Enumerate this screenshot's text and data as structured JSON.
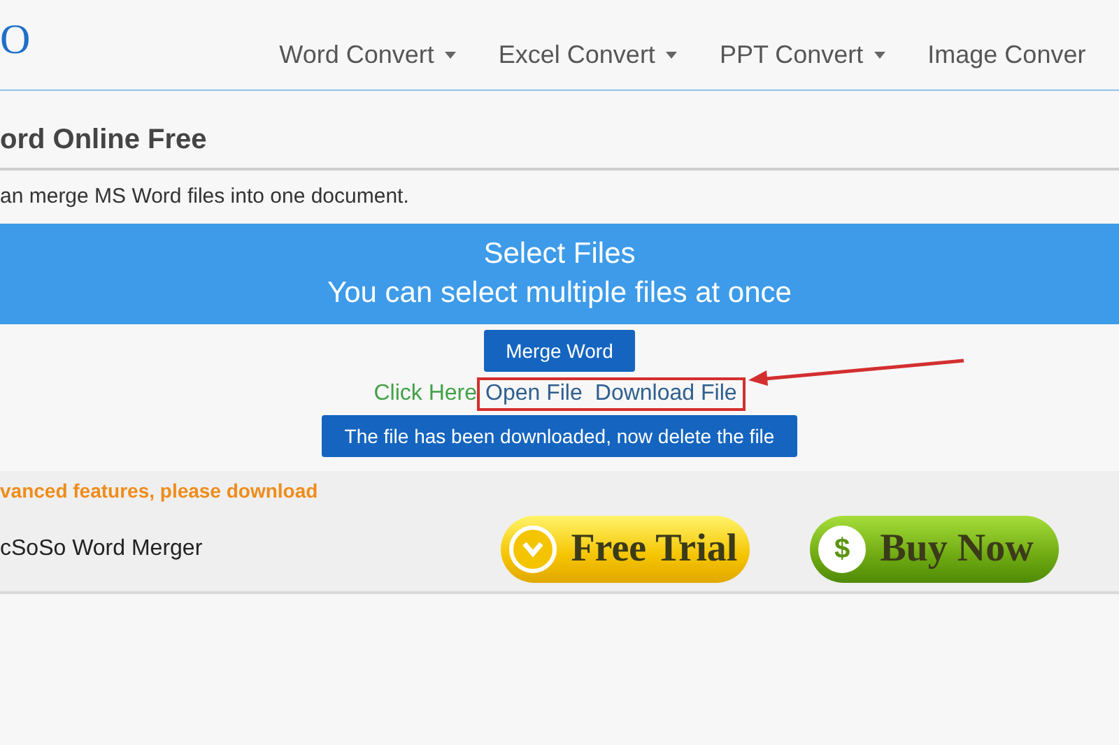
{
  "logo": "O",
  "nav": [
    {
      "label": "Word Convert",
      "dropdown": true
    },
    {
      "label": "Excel Convert",
      "dropdown": true
    },
    {
      "label": "PPT Convert",
      "dropdown": true
    },
    {
      "label": "Image Conver",
      "dropdown": false
    }
  ],
  "title": "ord Online Free",
  "description": "an merge MS Word files into one document.",
  "select_files": {
    "title": "Select Files",
    "subtitle": "You can select multiple files at once"
  },
  "merge_button": "Merge Word",
  "click_here": "Click Here",
  "links": [
    "Open File",
    "Download File"
  ],
  "links_highlighted": true,
  "status_button": "The file has been downloaded, now delete the file",
  "promo": {
    "notice": "vanced features, please download",
    "product": "cSoSo Word Merger",
    "buttons": [
      {
        "kind": "trial",
        "label": "Free Trial"
      },
      {
        "kind": "buy",
        "label": "Buy Now",
        "symbol": "$"
      }
    ]
  }
}
